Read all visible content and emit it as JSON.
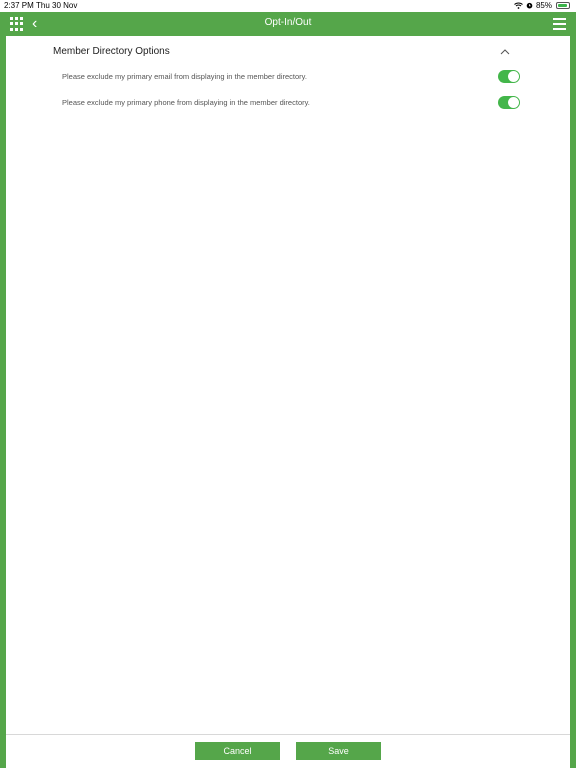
{
  "status_bar": {
    "time": "2:37 PM",
    "date": "Thu 30 Nov",
    "battery": "85%",
    "battery_fraction": 0.85,
    "icons": [
      "wifi-icon",
      "alarm-icon",
      "battery-icon"
    ]
  },
  "nav": {
    "title": "Opt-In/Out",
    "back_glyph": "‹",
    "icons": [
      "apps-grid-icon",
      "back-chevron-icon",
      "hamburger-menu-icon"
    ]
  },
  "section": {
    "title": "Member Directory Options",
    "expanded": true,
    "options": [
      {
        "label": "Please exclude my primary email from displaying in the member directory.",
        "enabled": true
      },
      {
        "label": "Please exclude my primary phone from displaying in the member directory.",
        "enabled": true
      }
    ]
  },
  "footer": {
    "cancel_label": "Cancel",
    "save_label": "Save"
  },
  "colors": {
    "brand_green": "#55a64a",
    "toggle_on": "#43b64a",
    "text_dark": "#222222",
    "text_muted": "#555555"
  }
}
